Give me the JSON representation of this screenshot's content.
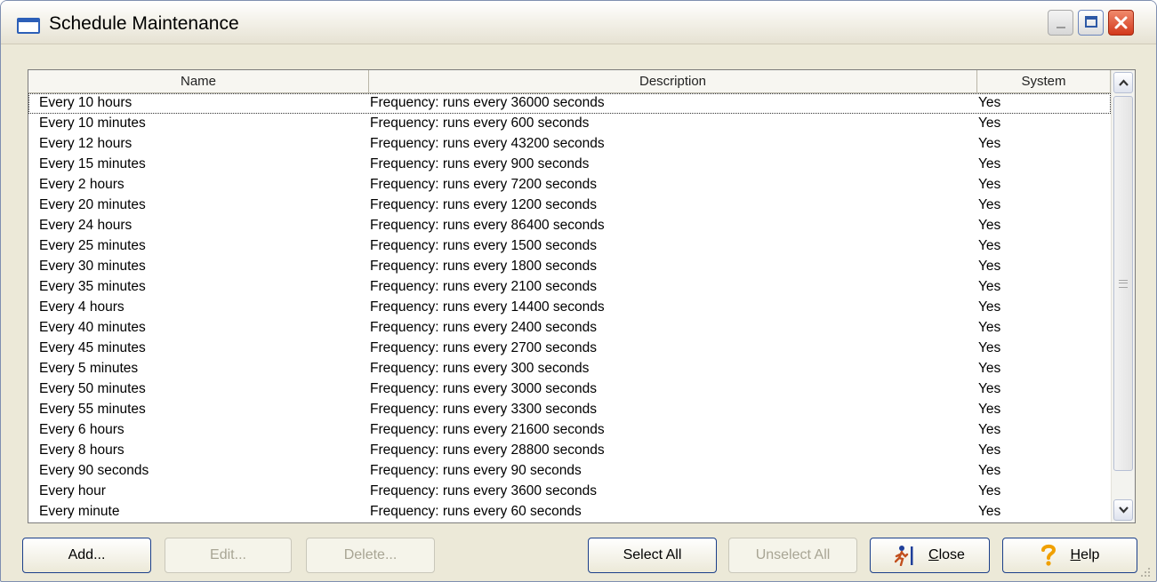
{
  "window": {
    "title": "Schedule Maintenance",
    "icon": "window-icon"
  },
  "columns": [
    "Name",
    "Description",
    "System"
  ],
  "rows": [
    {
      "name": "Every 10 hours",
      "description": "Frequency:  runs every 36000 seconds",
      "system": "Yes"
    },
    {
      "name": "Every 10 minutes",
      "description": "Frequency:  runs every 600 seconds",
      "system": "Yes"
    },
    {
      "name": "Every 12 hours",
      "description": "Frequency:  runs every 43200 seconds",
      "system": "Yes"
    },
    {
      "name": "Every 15 minutes",
      "description": "Frequency:  runs every 900 seconds",
      "system": "Yes"
    },
    {
      "name": "Every 2 hours",
      "description": "Frequency:  runs every 7200 seconds",
      "system": "Yes"
    },
    {
      "name": "Every 20 minutes",
      "description": "Frequency:  runs every 1200 seconds",
      "system": "Yes"
    },
    {
      "name": "Every 24 hours",
      "description": "Frequency:  runs every 86400 seconds",
      "system": "Yes"
    },
    {
      "name": "Every 25 minutes",
      "description": "Frequency:  runs every 1500 seconds",
      "system": "Yes"
    },
    {
      "name": "Every 30 minutes",
      "description": "Frequency:  runs every 1800 seconds",
      "system": "Yes"
    },
    {
      "name": "Every 35 minutes",
      "description": "Frequency:  runs every 2100 seconds",
      "system": "Yes"
    },
    {
      "name": "Every 4 hours",
      "description": "Frequency:  runs every 14400 seconds",
      "system": "Yes"
    },
    {
      "name": "Every 40 minutes",
      "description": "Frequency:  runs every 2400 seconds",
      "system": "Yes"
    },
    {
      "name": "Every 45 minutes",
      "description": "Frequency:  runs every 2700 seconds",
      "system": "Yes"
    },
    {
      "name": "Every 5 minutes",
      "description": "Frequency:  runs every 300 seconds",
      "system": "Yes"
    },
    {
      "name": "Every 50 minutes",
      "description": "Frequency:  runs every 3000 seconds",
      "system": "Yes"
    },
    {
      "name": "Every 55 minutes",
      "description": "Frequency:  runs every 3300 seconds",
      "system": "Yes"
    },
    {
      "name": "Every 6 hours",
      "description": "Frequency:  runs every 21600 seconds",
      "system": "Yes"
    },
    {
      "name": "Every 8 hours",
      "description": "Frequency:  runs every 28800 seconds",
      "system": "Yes"
    },
    {
      "name": "Every 90 seconds",
      "description": "Frequency:  runs every 90 seconds",
      "system": "Yes"
    },
    {
      "name": "Every hour",
      "description": "Frequency:  runs every 3600 seconds",
      "system": "Yes"
    },
    {
      "name": "Every minute",
      "description": "Frequency:  runs every 60 seconds",
      "system": "Yes"
    }
  ],
  "selected_row": 0,
  "buttons": {
    "add": "Add...",
    "edit": "Edit...",
    "delete": "Delete...",
    "select_all": "Select All",
    "unselect_all": "Unselect All",
    "close_prefix": "",
    "close_mnemonic": "C",
    "close_rest": "lose",
    "help_mnemonic": "H",
    "help_rest": "elp"
  },
  "icons": {
    "close_button": "running-man-icon",
    "help_button": "question-mark-icon"
  },
  "colors": {
    "window_bg": "#ece9d8",
    "title_close": "#d2381b",
    "accent_blue": "#2c5fb8",
    "help_icon": "#f0a000",
    "disabled_text": "#a8a594"
  }
}
